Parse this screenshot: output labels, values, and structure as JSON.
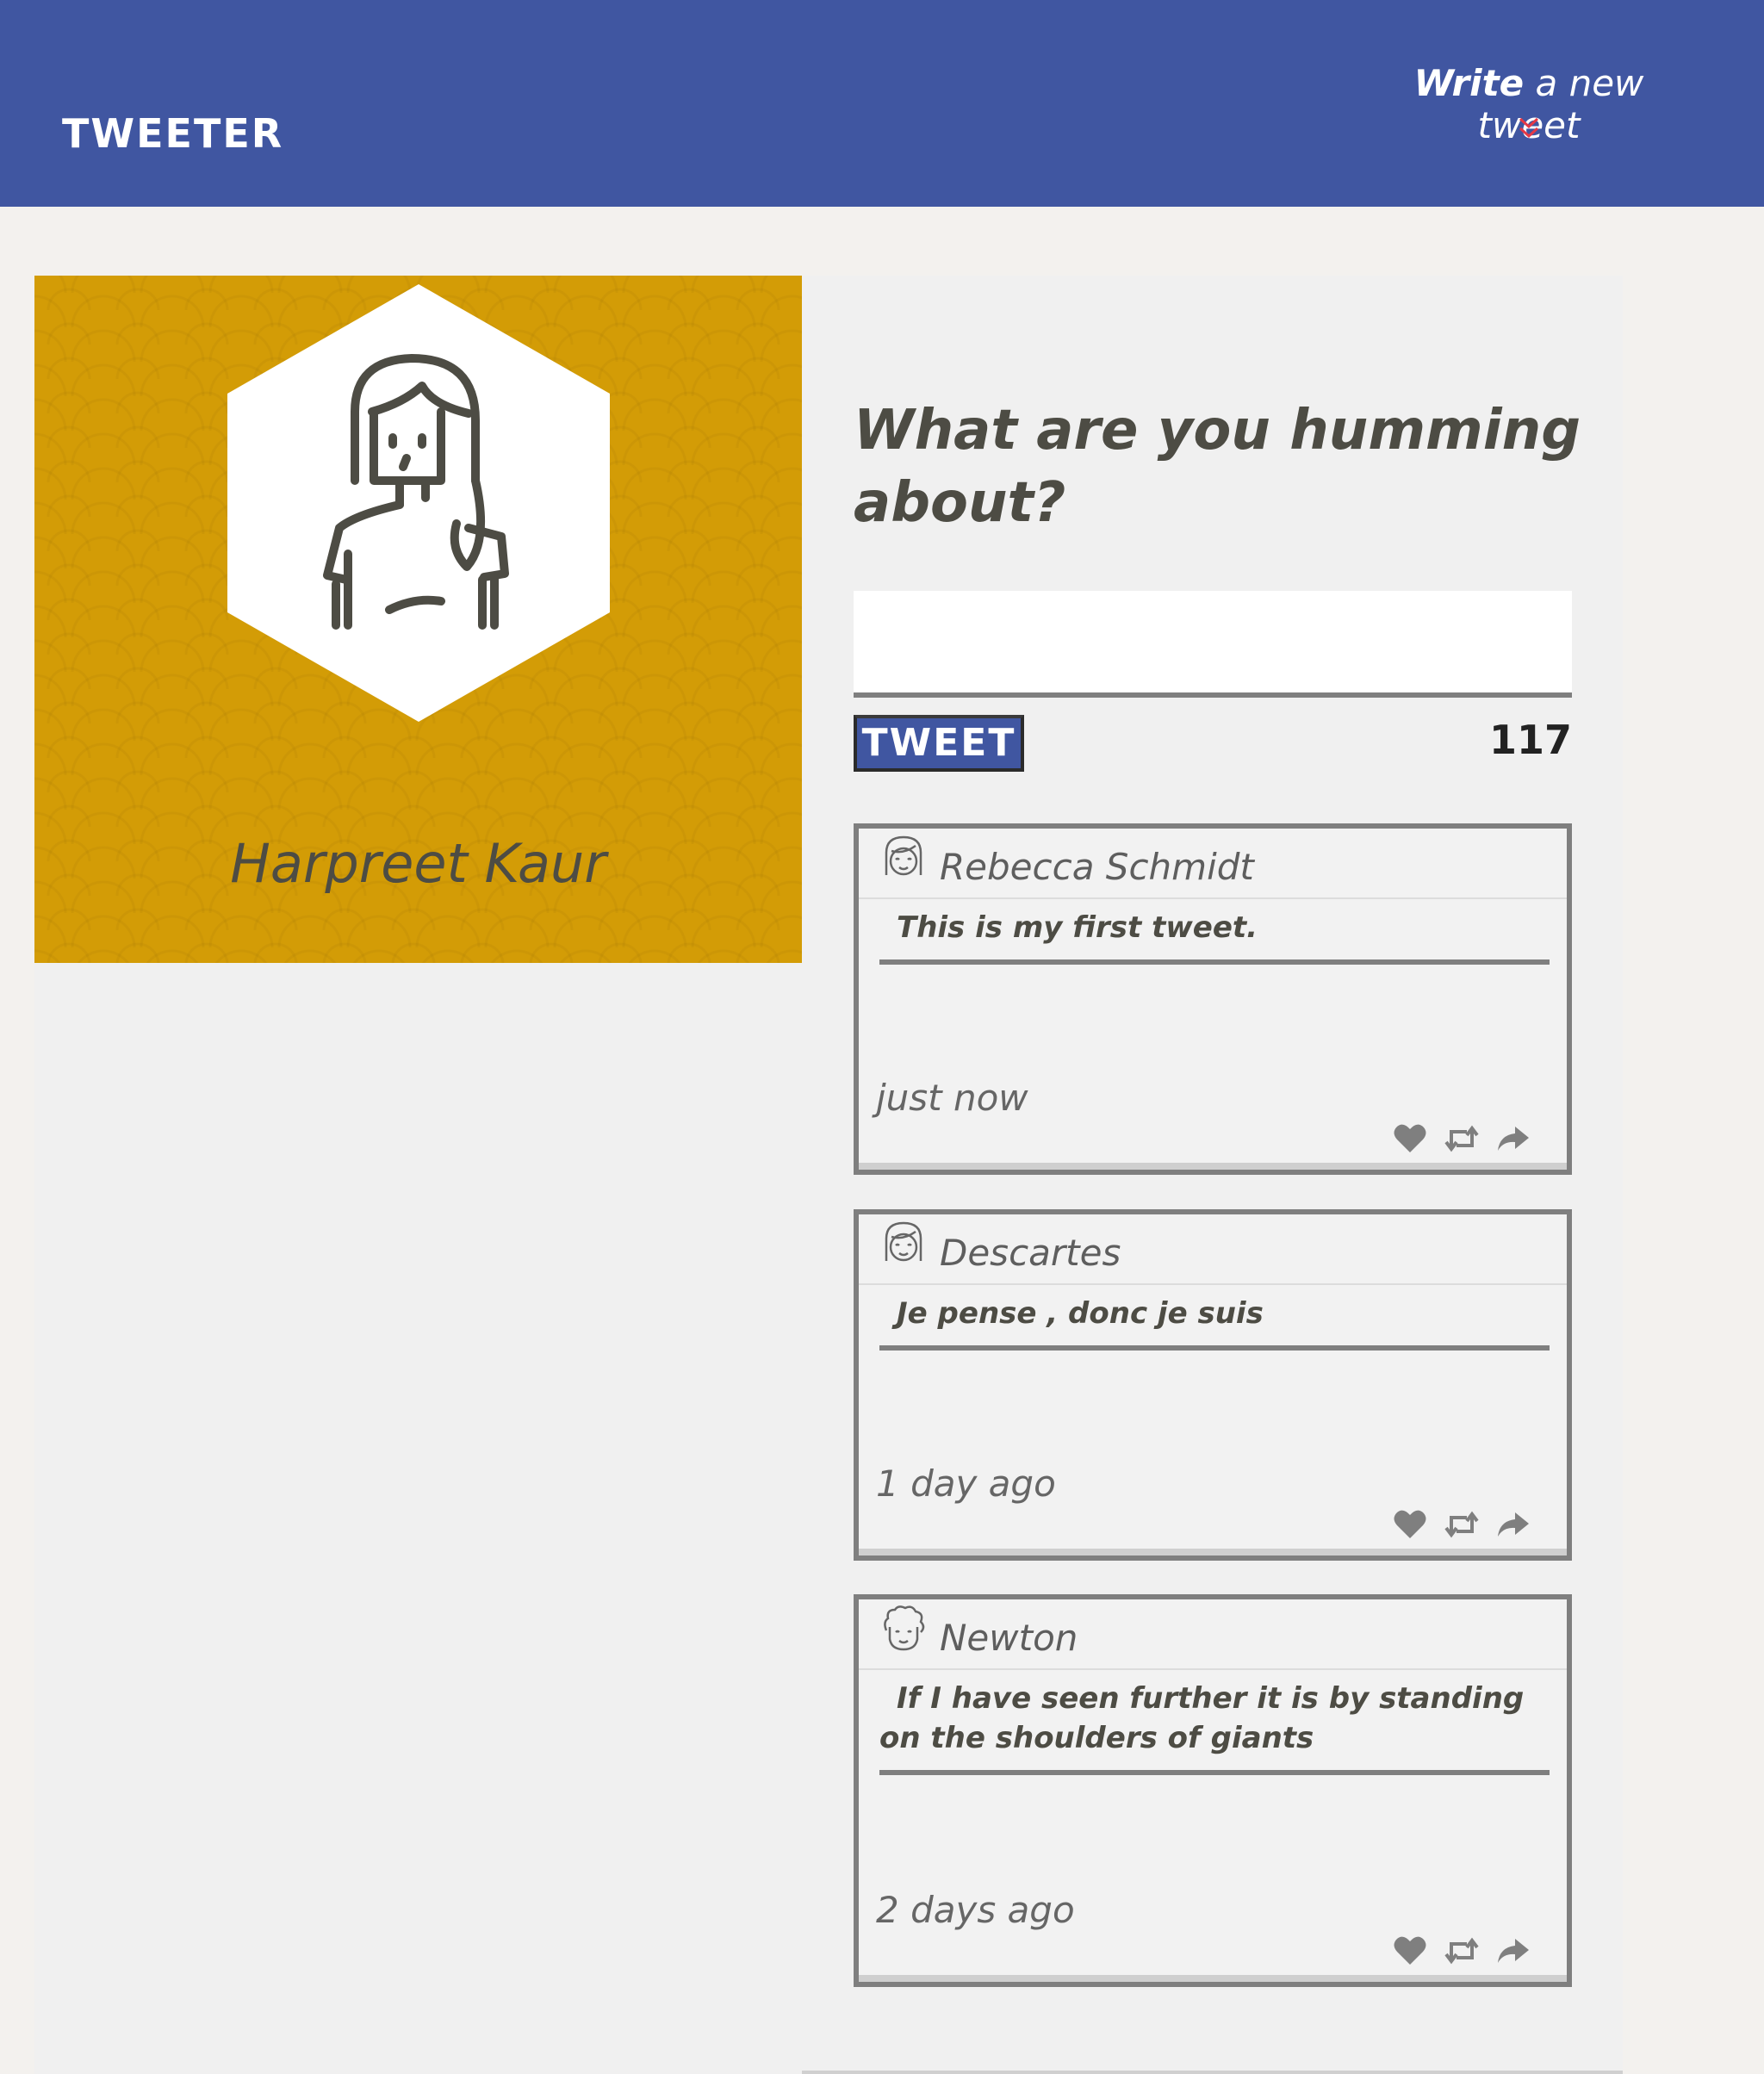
{
  "header": {
    "logo": "TWEETER",
    "write_bold": "Write",
    "write_rest": " a new tweet",
    "chevron_icon": "double-chevron-down-icon",
    "colors": {
      "bar": "#4056a1",
      "chevron": "#e63946"
    }
  },
  "profile": {
    "name": "Harpreet Kaur",
    "avatar_icon": "woman-avatar-icon",
    "background_color": "#d39c06"
  },
  "compose": {
    "title": "What are you humming about?",
    "input_value": "",
    "button_label": "TWEET",
    "counter": "117"
  },
  "tweets": [
    {
      "author": "Rebecca Schmidt",
      "avatar_icon": "girl-avatar-icon",
      "text": "This is my first tweet.",
      "time": "just now",
      "actions": [
        "heart-icon",
        "retweet-icon",
        "share-icon"
      ]
    },
    {
      "author": "Descartes",
      "avatar_icon": "girl-avatar-icon",
      "text": "Je pense , donc je suis",
      "time": "1 day ago",
      "actions": [
        "heart-icon",
        "retweet-icon",
        "share-icon"
      ]
    },
    {
      "author": "Newton",
      "avatar_icon": "curly-hair-avatar-icon",
      "text": "If I have seen further it is by standing on the shoulders of giants",
      "time": "2 days ago",
      "actions": [
        "heart-icon",
        "retweet-icon",
        "share-icon"
      ]
    }
  ]
}
